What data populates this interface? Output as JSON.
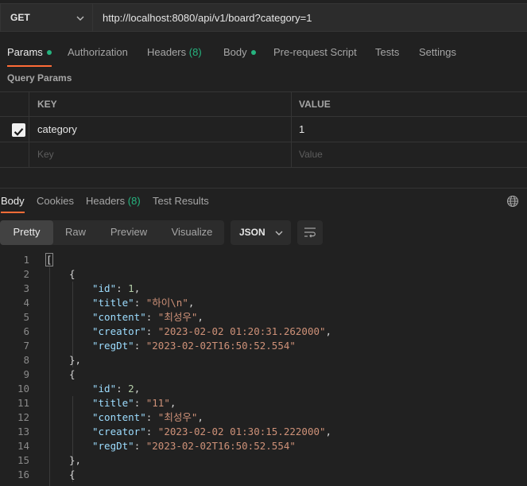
{
  "request": {
    "method": "GET",
    "url": "http://localhost:8080/api/v1/board?category=1"
  },
  "request_tabs": [
    {
      "label": "Params",
      "dot": true,
      "active": true
    },
    {
      "label": "Authorization"
    },
    {
      "label": "Headers",
      "count": "(8)"
    },
    {
      "label": "Body",
      "dot": true
    },
    {
      "label": "Pre-request Script"
    },
    {
      "label": "Tests"
    },
    {
      "label": "Settings"
    }
  ],
  "query_params": {
    "title": "Query Params",
    "columns": {
      "key": "KEY",
      "value": "VALUE"
    },
    "rows": [
      {
        "checked": true,
        "key": "category",
        "value": "1"
      }
    ],
    "placeholder": {
      "key": "Key",
      "value": "Value"
    }
  },
  "response_tabs": [
    {
      "label": "Body",
      "active": true
    },
    {
      "label": "Cookies"
    },
    {
      "label": "Headers",
      "count": "(8)"
    },
    {
      "label": "Test Results"
    }
  ],
  "view_modes": [
    "Pretty",
    "Raw",
    "Preview",
    "Visualize"
  ],
  "active_view_mode": "Pretty",
  "format": "JSON",
  "code_lines": [
    {
      "n": "1",
      "t": "["
    },
    {
      "n": "2",
      "t": "{"
    },
    {
      "n": "3",
      "key": "id",
      "num": "1"
    },
    {
      "n": "4",
      "key": "title",
      "str": "하이\\n"
    },
    {
      "n": "5",
      "key": "content",
      "str": "최성우"
    },
    {
      "n": "6",
      "key": "creator",
      "str": "2023-02-02 01:20:31.262000"
    },
    {
      "n": "7",
      "key": "regDt",
      "str": "2023-02-02T16:50:52.554",
      "last": true
    },
    {
      "n": "8",
      "t": "},"
    },
    {
      "n": "9",
      "t": "{"
    },
    {
      "n": "10",
      "key": "id",
      "num": "2"
    },
    {
      "n": "11",
      "key": "title",
      "str": "11"
    },
    {
      "n": "12",
      "key": "content",
      "str": "최성우"
    },
    {
      "n": "13",
      "key": "creator",
      "str": "2023-02-02 01:30:15.222000"
    },
    {
      "n": "14",
      "key": "regDt",
      "str": "2023-02-02T16:50:52.554",
      "last": true
    },
    {
      "n": "15",
      "t": "},"
    },
    {
      "n": "16",
      "t": "{"
    }
  ],
  "colors": {
    "accent": "#ff6c37",
    "status_dot": "#26b47f",
    "json_key": "#9cdcfe",
    "json_string": "#ce9178",
    "json_number": "#b5cea8"
  }
}
